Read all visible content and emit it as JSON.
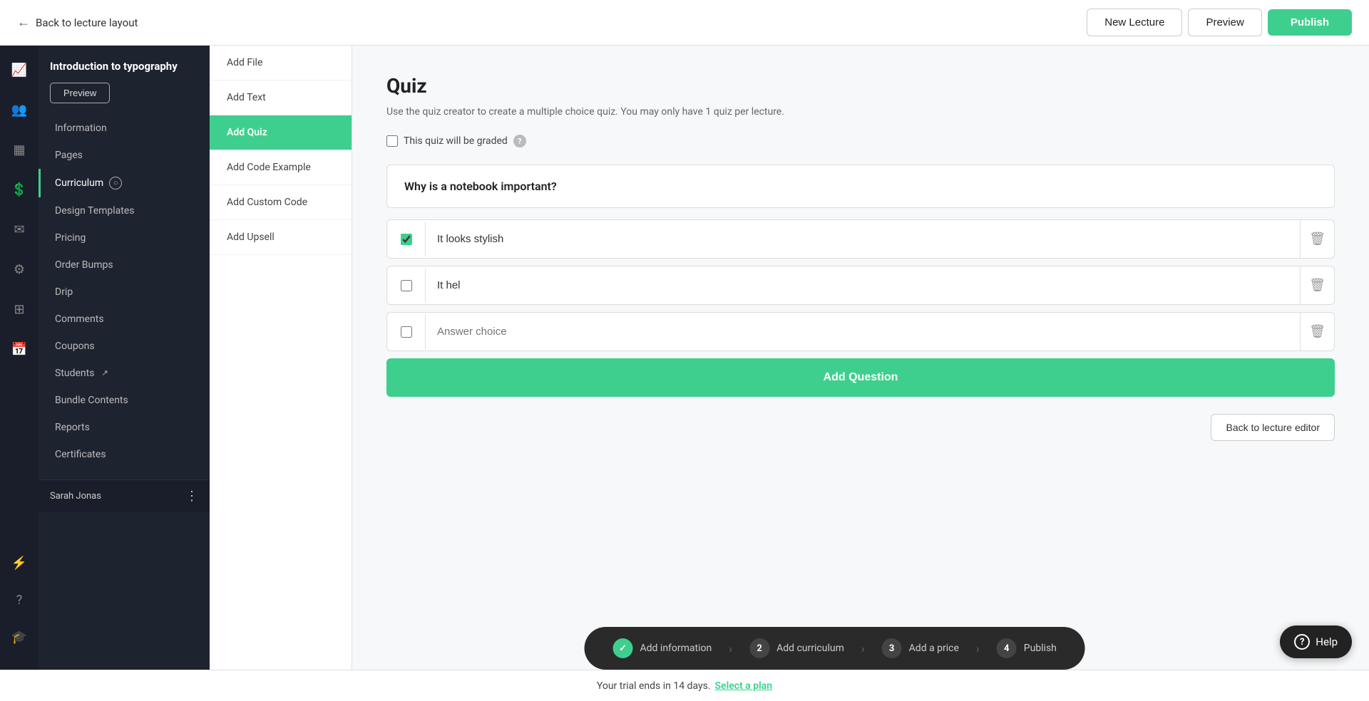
{
  "topbar": {
    "back_label": "Back to lecture layout",
    "new_lecture_label": "New Lecture",
    "preview_label": "Preview",
    "publish_label": "Publish"
  },
  "sidebar": {
    "title": "Introduction to typography",
    "preview_btn": "Preview",
    "nav_items": [
      {
        "id": "information",
        "label": "Information",
        "active": false
      },
      {
        "id": "pages",
        "label": "Pages",
        "active": false
      },
      {
        "id": "curriculum",
        "label": "Curriculum",
        "active": true,
        "badge": true
      },
      {
        "id": "design_templates",
        "label": "Design Templates",
        "active": false
      },
      {
        "id": "pricing",
        "label": "Pricing",
        "active": false
      },
      {
        "id": "order_bumps",
        "label": "Order Bumps",
        "active": false
      },
      {
        "id": "drip",
        "label": "Drip",
        "active": false
      },
      {
        "id": "comments",
        "label": "Comments",
        "active": false
      },
      {
        "id": "coupons",
        "label": "Coupons",
        "active": false
      },
      {
        "id": "students",
        "label": "Students",
        "active": false,
        "external": true
      },
      {
        "id": "bundle_contents",
        "label": "Bundle Contents",
        "active": false
      },
      {
        "id": "reports",
        "label": "Reports",
        "active": false
      },
      {
        "id": "certificates",
        "label": "Certificates",
        "active": false
      }
    ],
    "user_name": "Sarah Jonas"
  },
  "lecture_nav": {
    "items": [
      {
        "id": "add_file",
        "label": "Add File",
        "active": false
      },
      {
        "id": "add_text",
        "label": "Add Text",
        "active": false
      },
      {
        "id": "add_quiz",
        "label": "Add Quiz",
        "active": true
      },
      {
        "id": "add_code_example",
        "label": "Add Code Example",
        "active": false
      },
      {
        "id": "add_custom_code",
        "label": "Add Custom Code",
        "active": false
      },
      {
        "id": "add_upsell",
        "label": "Add Upsell",
        "active": false
      }
    ]
  },
  "quiz": {
    "title": "Quiz",
    "description": "Use the quiz creator to create a multiple choice quiz. You may only have 1 quiz per lecture.",
    "graded_label": "This quiz will be graded",
    "graded_checked": false,
    "question": "Why is a notebook important?",
    "answers": [
      {
        "id": "a1",
        "text": "It looks stylish",
        "checked": true,
        "placeholder": false
      },
      {
        "id": "a2",
        "text": "It hel",
        "checked": false,
        "placeholder": false
      },
      {
        "id": "a3",
        "text": "",
        "checked": false,
        "placeholder": true
      }
    ],
    "answer_placeholder": "Answer choice",
    "add_question_label": "Add Question",
    "back_editor_label": "Back to lecture editor"
  },
  "wizard": {
    "steps": [
      {
        "num": "✓",
        "label": "Add information",
        "done": true
      },
      {
        "num": "2",
        "label": "Add curriculum",
        "done": false
      },
      {
        "num": "3",
        "label": "Add a price",
        "done": false
      },
      {
        "num": "4",
        "label": "Publish",
        "done": false
      }
    ]
  },
  "trial": {
    "text": "Your trial ends in 14 days.",
    "link_text": "Select a plan"
  },
  "help": {
    "label": "Help"
  },
  "icons": {
    "trending": "📈",
    "users": "👥",
    "dashboard": "▦",
    "dollar": "💲",
    "mail": "✉",
    "settings": "⚙",
    "blocks": "⊞",
    "calendar": "📅",
    "lightning": "⚡",
    "question": "?",
    "school": "🎓"
  }
}
